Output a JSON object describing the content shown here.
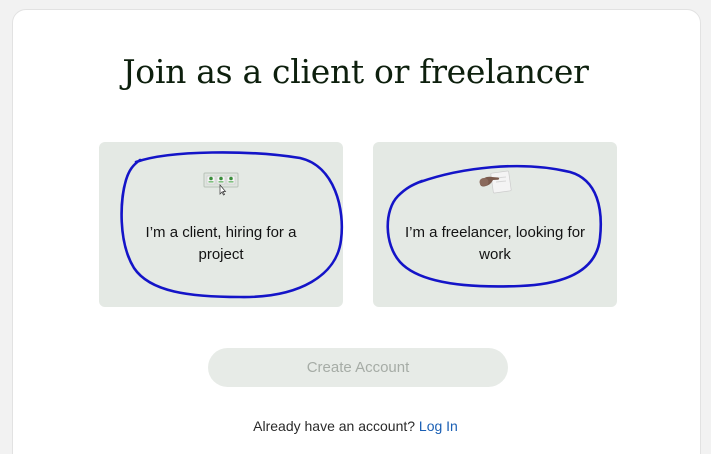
{
  "heading": "Join as a client or freelancer",
  "cards": [
    {
      "id": "client",
      "label": "I’m a client, hiring for a project",
      "icon": "client-select-icon"
    },
    {
      "id": "freelancer",
      "label": "I’m a freelancer, looking for work",
      "icon": "freelancer-hand-icon"
    }
  ],
  "create_account": {
    "label": "Create Account",
    "enabled": false
  },
  "login": {
    "prompt": "Already have an account?",
    "link_label": "Log In"
  },
  "colors": {
    "card_bg": "#e4e9e4",
    "annotation_stroke": "#1414c8",
    "link": "#1a5fb4",
    "disabled_button_bg": "#e7ebe7",
    "disabled_button_text": "#a6aca6"
  }
}
